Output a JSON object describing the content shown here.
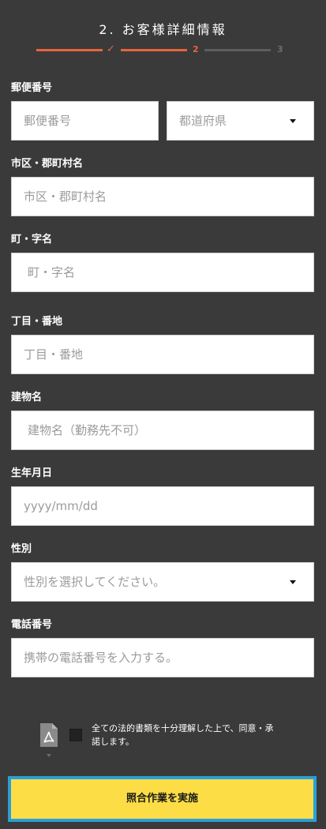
{
  "header": {
    "title": "2. お客様詳細情報",
    "steps": [
      {
        "mark": "✓",
        "state": "completed"
      },
      {
        "mark": "2",
        "state": "current"
      },
      {
        "mark": "3",
        "state": "upcoming"
      }
    ]
  },
  "colors": {
    "background": "#3a3a3a",
    "accent": "#e8643a",
    "submit_bg": "#fcdd45",
    "submit_border": "#2a9fd8"
  },
  "form": {
    "postal_code": {
      "label": "郵便番号",
      "placeholder": "郵便番号",
      "value": ""
    },
    "prefecture": {
      "placeholder": "都道府県",
      "value": ""
    },
    "city": {
      "label": "市区・郡町村名",
      "placeholder": "市区・郡町村名",
      "value": ""
    },
    "town": {
      "label": "町・字名",
      "placeholder": "町・字名",
      "value": ""
    },
    "block": {
      "label": "丁目・番地",
      "placeholder": "丁目・番地",
      "value": ""
    },
    "building": {
      "label": "建物名",
      "placeholder": "建物名（勤務先不可）",
      "value": ""
    },
    "birthdate": {
      "label": "生年月日",
      "placeholder": "yyyy/mm/dd",
      "value": ""
    },
    "gender": {
      "label": "性別",
      "placeholder": "性別を選択してください。",
      "value": ""
    },
    "phone": {
      "label": "電話番号",
      "placeholder": "携帯の電話番号を入力する。",
      "value": ""
    }
  },
  "consent": {
    "text": "全ての法的書類を十分理解した上で、同意・承諾します。",
    "checked": false,
    "icon": "pdf-document-icon"
  },
  "submit": {
    "label": "照合作業を実施"
  }
}
